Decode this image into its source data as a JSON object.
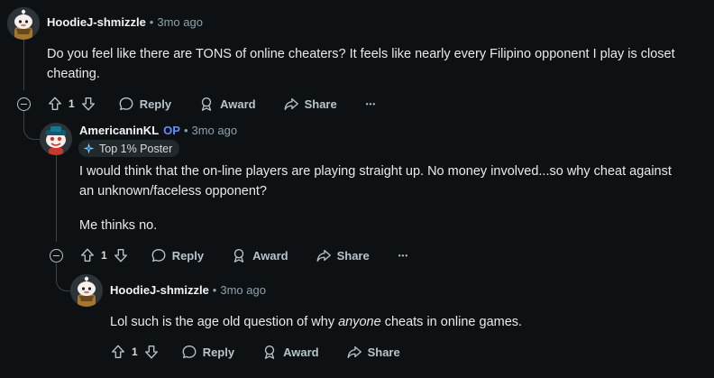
{
  "comments": [
    {
      "author": "HoodieJ-shmizzle",
      "time": "3mo ago",
      "lines": [
        "Do you feel like there are TONS of online cheaters? It feels like nearly every Filipino opponent I play is closet",
        "cheating."
      ],
      "votes": "1",
      "actions": {
        "reply": "Reply",
        "award": "Award",
        "share": "Share",
        "more": "•••"
      }
    },
    {
      "author": "AmericaninKL",
      "op_tag": "OP",
      "time": "3mo ago",
      "flair": "Top 1% Poster",
      "lines": [
        "I would think that the on-line players are playing straight up. No money involved...so why cheat against",
        "an unknown/faceless opponent?",
        "Me thinks no."
      ],
      "votes": "1",
      "actions": {
        "reply": "Reply",
        "award": "Award",
        "share": "Share",
        "more": "•••"
      }
    },
    {
      "author": "HoodieJ-shmizzle",
      "time": "3mo ago",
      "text_before": "Lol such is the age old question of why ",
      "text_em": "anyone",
      "text_after": " cheats in online games.",
      "votes": "1",
      "actions": {
        "reply": "Reply",
        "award": "Award",
        "share": "Share"
      }
    }
  ],
  "colors": {
    "background": "#0e1113",
    "op": "#648efc",
    "meta": "#8ba2ad"
  },
  "icons": [
    "upvote-icon",
    "downvote-icon",
    "reply-icon",
    "award-icon",
    "share-icon",
    "collapse-icon",
    "flair-star-icon"
  ]
}
